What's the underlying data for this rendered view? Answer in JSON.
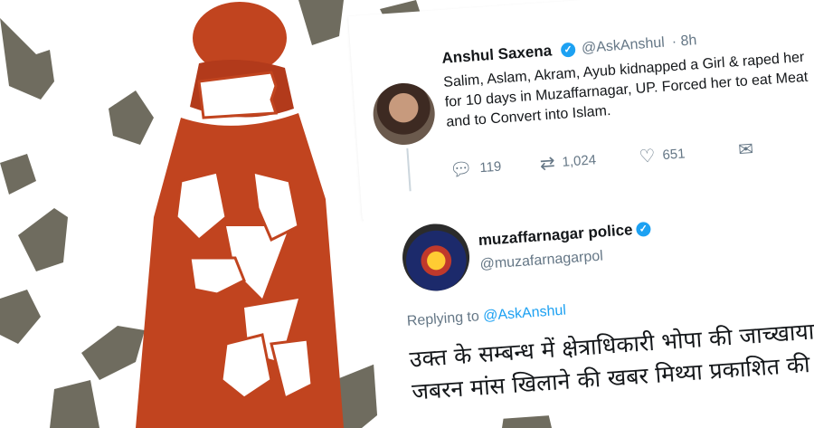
{
  "tweet1": {
    "name": "Anshul Saxena",
    "handle": "@AskAnshul",
    "time": "· 8h",
    "text": "Salim, Aslam, Akram, Ayub kidnapped a Girl & raped her for 10 days in Muzaffarnagar, UP.  Forced her to eat Meat and to Convert into Islam.",
    "replies": "119",
    "retweets": "1,024",
    "likes": "651"
  },
  "tweet2": {
    "name": "muzaffarnagar police",
    "handle": "@muzafarnagarpol",
    "replying_label": "Replying to",
    "replying_handle": "@AskAnshul",
    "line1": "उक्त के सम्बन्ध में क्षेत्राधिकारी भोपा की जाच्खायान",
    "line2": "जबरन मांस खिलाने की खबर मिथ्या प्रकाशित की"
  },
  "colors": {
    "accent": "#1da1f2",
    "illustration_orange": "#c1441f",
    "hand_gray": "#6b6b5e"
  },
  "icons": [
    "chevron-down-icon",
    "verified-icon",
    "reply-icon",
    "retweet-icon",
    "like-icon",
    "message-icon"
  ]
}
